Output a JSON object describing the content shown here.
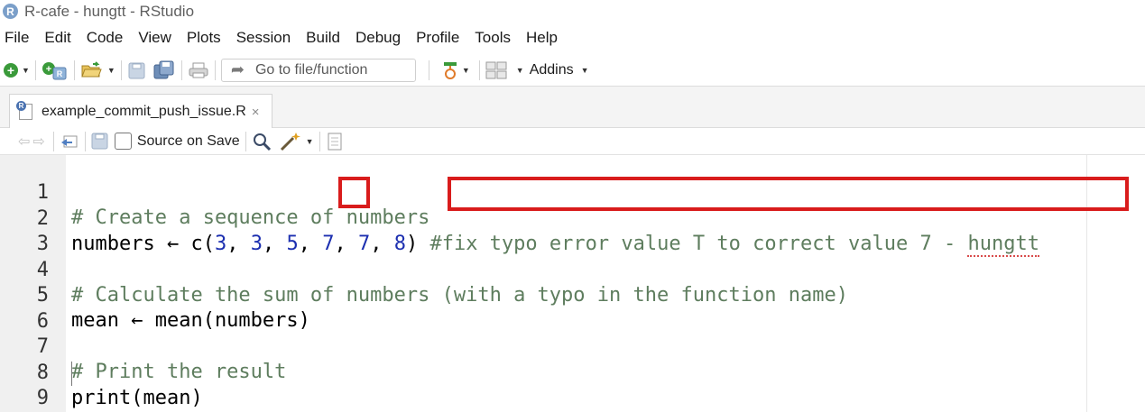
{
  "window": {
    "title": "R-cafe - hungtt - RStudio",
    "app_icon_letter": "R"
  },
  "menu": [
    "File",
    "Edit",
    "Code",
    "View",
    "Plots",
    "Session",
    "Build",
    "Debug",
    "Profile",
    "Tools",
    "Help"
  ],
  "toolbar": {
    "goto_placeholder": "Go to file/function",
    "addins_label": "Addins"
  },
  "editor_tab": {
    "filename": "example_commit_push_issue.R",
    "close_glyph": "×"
  },
  "editor_toolbar": {
    "source_on_save_label": "Source on Save",
    "source_on_save_checked": false
  },
  "code": {
    "line_numbers": [
      "1",
      "2",
      "3",
      "4",
      "5",
      "6",
      "7",
      "8",
      "9"
    ],
    "line1": "# Create a sequence of numbers",
    "line2": {
      "prefix": "numbers ← c(",
      "v1": "3",
      "sep1": ", ",
      "v2": "3",
      "sep2": ", ",
      "v3": "5",
      "sep3": ", ",
      "v4": "7",
      "sep4": ", ",
      "v5": "7",
      "sep5": ", ",
      "v6": "8",
      "suffix": ") ",
      "comment_main": "#fix typo error value T to correct value 7 - ",
      "comment_name": "hungtt"
    },
    "line4": "# Calculate the sum of numbers (with a typo in the function name)",
    "line5": "mean ← mean(numbers)",
    "line7": "# Print the result",
    "line8": "print(mean)"
  },
  "colors": {
    "highlight_box": "#d91c1c",
    "comment": "#5e7d5e",
    "number": "#1c2fb0"
  }
}
